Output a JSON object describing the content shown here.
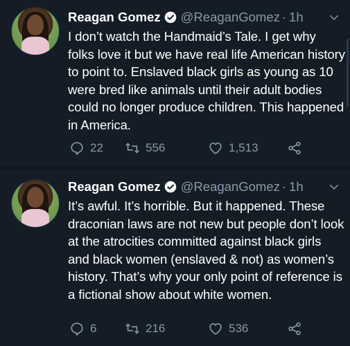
{
  "tweets": [
    {
      "name": "Reagan Gomez",
      "handle": "@ReaganGomez",
      "dot": "·",
      "time": "1h",
      "text": "I don’t watch the Handmaid’s Tale. I get why folks love it but we have real life American history to point to. Enslaved black girls as young as 10 were bred like animals until their adult bodies could no longer produce children. This happened in America.",
      "replies": "22",
      "retweets": "556",
      "likes": "1,513"
    },
    {
      "name": "Reagan Gomez",
      "handle": "@ReaganGomez",
      "dot": "·",
      "time": "1h",
      "text": "It’s awful. It’s horrible. But it happened. These draconian laws are not new but people don’t look at the atrocities committed against black girls and black women (enslaved & not) as women’s history. That’s why your only point of reference is a fictional show about white women.",
      "replies": "6",
      "retweets": "216",
      "likes": "536"
    }
  ],
  "icons": {
    "verified": "verified-badge-icon",
    "chevron": "chevron-down-icon",
    "reply": "reply-icon",
    "retweet": "retweet-icon",
    "like": "heart-icon",
    "share": "share-icon"
  },
  "colors": {
    "background": "#141d26",
    "text": "#ffffff",
    "secondary": "#8899a6"
  }
}
